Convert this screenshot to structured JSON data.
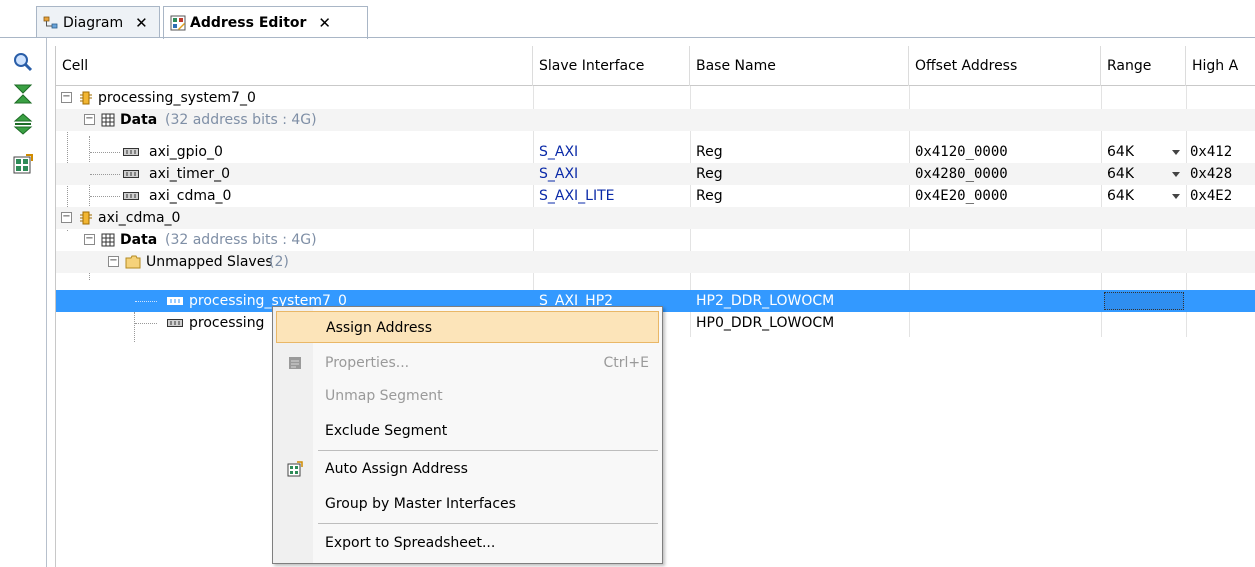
{
  "tabs": [
    {
      "label": "Diagram",
      "close": "✕",
      "icon": "diagram-icon",
      "active": false
    },
    {
      "label": "Address Editor",
      "close": "✕",
      "icon": "address-editor-icon",
      "active": true
    }
  ],
  "toolbar": {
    "icons": [
      "search-icon",
      "collapse-all-icon",
      "expand-all-icon",
      "auto-assign-icon"
    ]
  },
  "table": {
    "columns": [
      "Cell",
      "Slave Interface",
      "Base Name",
      "Offset Address",
      "Range",
      "High A"
    ],
    "rows": [
      {
        "cell": "processing_system7_0",
        "sub": "",
        "slave": "",
        "base": "",
        "offset": "",
        "range": "",
        "high": ""
      },
      {
        "cell": "Data",
        "sub": "(32 address bits : 4G)",
        "slave": "",
        "base": "",
        "offset": "",
        "range": "",
        "high": ""
      },
      {
        "cell": "axi_gpio_0",
        "sub": "",
        "slave": "S_AXI",
        "base": "Reg",
        "offset": "0x4120_0000",
        "range": "64K",
        "high": "0x412"
      },
      {
        "cell": "axi_timer_0",
        "sub": "",
        "slave": "S_AXI",
        "base": "Reg",
        "offset": "0x4280_0000",
        "range": "64K",
        "high": "0x428"
      },
      {
        "cell": "axi_cdma_0",
        "sub": "",
        "slave": "S_AXI_LITE",
        "base": "Reg",
        "offset": "0x4E20_0000",
        "range": "64K",
        "high": "0x4E2"
      },
      {
        "cell": "axi_cdma_0",
        "sub": "",
        "slave": "",
        "base": "",
        "offset": "",
        "range": "",
        "high": ""
      },
      {
        "cell": "Data",
        "sub": "(32 address bits : 4G)",
        "slave": "",
        "base": "",
        "offset": "",
        "range": "",
        "high": ""
      },
      {
        "cell": "Unmapped Slaves",
        "sub": "(2)",
        "slave": "",
        "base": "",
        "offset": "",
        "range": "",
        "high": ""
      },
      {
        "cell": "processing_system7_0",
        "sub": "",
        "slave": "S_AXI_HP2",
        "base": "HP2_DDR_LOWOCM",
        "offset": "",
        "range": "",
        "high": ""
      },
      {
        "cell": "processing",
        "sub": "",
        "slave": "",
        "base": "HP0_DDR_LOWOCM",
        "offset": "",
        "range": "",
        "high": ""
      }
    ]
  },
  "context_menu": {
    "items": [
      {
        "label": "Assign Address",
        "shortcut": "",
        "disabled": false,
        "highlighted": true
      },
      {
        "label": "Properties...",
        "shortcut": "Ctrl+E",
        "disabled": true,
        "highlighted": false
      },
      {
        "label": "Unmap Segment",
        "shortcut": "",
        "disabled": true,
        "highlighted": false
      },
      {
        "label": "Exclude Segment",
        "shortcut": "",
        "disabled": false,
        "highlighted": false
      },
      {
        "label": "Auto Assign Address",
        "shortcut": "",
        "disabled": false,
        "highlighted": false
      },
      {
        "label": "Group by Master Interfaces",
        "shortcut": "",
        "disabled": false,
        "highlighted": false
      },
      {
        "label": "Export to Spreadsheet...",
        "shortcut": "",
        "disabled": false,
        "highlighted": false
      }
    ]
  },
  "colors": {
    "selection": "#3399ff",
    "link": "#0a2aa8",
    "menu_highlight": "#fce4b9"
  }
}
